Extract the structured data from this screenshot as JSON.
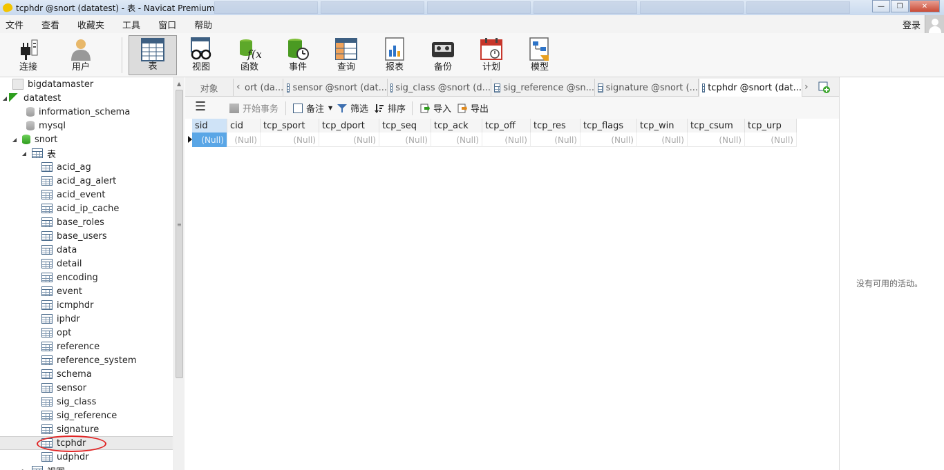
{
  "window": {
    "title": "tcphdr @snort (datatest) - 表 - Navicat Premium",
    "controls": [
      "—",
      "❐",
      "✕"
    ]
  },
  "menu": {
    "items": [
      "文件",
      "查看",
      "收藏夹",
      "工具",
      "窗口",
      "帮助"
    ],
    "login": "登录"
  },
  "toolbar": {
    "buttons": [
      {
        "label": "连接",
        "icon": "plug-icon"
      },
      {
        "label": "用户",
        "icon": "user-icon"
      },
      {
        "label": "表",
        "icon": "table-icon",
        "active": true
      },
      {
        "label": "视图",
        "icon": "view-glasses-icon"
      },
      {
        "label": "函数",
        "icon": "function-icon"
      },
      {
        "label": "事件",
        "icon": "event-clock-icon"
      },
      {
        "label": "查询",
        "icon": "query-icon"
      },
      {
        "label": "报表",
        "icon": "report-icon"
      },
      {
        "label": "备份",
        "icon": "backup-tape-icon"
      },
      {
        "label": "计划",
        "icon": "calendar-icon"
      },
      {
        "label": "模型",
        "icon": "model-icon"
      }
    ]
  },
  "tree": {
    "nodes": [
      {
        "label": "bigdatamaster",
        "level": 0,
        "type": "connection"
      },
      {
        "label": "datatest",
        "level": 0,
        "type": "connection-open",
        "expanded": true
      },
      {
        "label": "information_schema",
        "level": 1,
        "type": "database"
      },
      {
        "label": "mysql",
        "level": 1,
        "type": "database"
      },
      {
        "label": "snort",
        "level": 1,
        "type": "database-open",
        "expanded": true
      },
      {
        "label": "表",
        "level": 2,
        "type": "folder",
        "expanded": true
      },
      {
        "label": "acid_ag",
        "level": 3,
        "type": "table"
      },
      {
        "label": "acid_ag_alert",
        "level": 3,
        "type": "table"
      },
      {
        "label": "acid_event",
        "level": 3,
        "type": "table"
      },
      {
        "label": "acid_ip_cache",
        "level": 3,
        "type": "table"
      },
      {
        "label": "base_roles",
        "level": 3,
        "type": "table"
      },
      {
        "label": "base_users",
        "level": 3,
        "type": "table"
      },
      {
        "label": "data",
        "level": 3,
        "type": "table"
      },
      {
        "label": "detail",
        "level": 3,
        "type": "table"
      },
      {
        "label": "encoding",
        "level": 3,
        "type": "table"
      },
      {
        "label": "event",
        "level": 3,
        "type": "table"
      },
      {
        "label": "icmphdr",
        "level": 3,
        "type": "table"
      },
      {
        "label": "iphdr",
        "level": 3,
        "type": "table"
      },
      {
        "label": "opt",
        "level": 3,
        "type": "table"
      },
      {
        "label": "reference",
        "level": 3,
        "type": "table"
      },
      {
        "label": "reference_system",
        "level": 3,
        "type": "table"
      },
      {
        "label": "schema",
        "level": 3,
        "type": "table"
      },
      {
        "label": "sensor",
        "level": 3,
        "type": "table"
      },
      {
        "label": "sig_class",
        "level": 3,
        "type": "table"
      },
      {
        "label": "sig_reference",
        "level": 3,
        "type": "table"
      },
      {
        "label": "signature",
        "level": 3,
        "type": "table"
      },
      {
        "label": "tcphdr",
        "level": 3,
        "type": "table",
        "selected": true
      },
      {
        "label": "udphdr",
        "level": 3,
        "type": "table"
      },
      {
        "label": "视图",
        "level": 2,
        "type": "folder"
      }
    ]
  },
  "tabs": {
    "objects_label": "对象",
    "items": [
      {
        "label": "ort (da..."
      },
      {
        "label": "sensor @snort (dat..."
      },
      {
        "label": "sig_class @snort (d..."
      },
      {
        "label": "sig_reference @sn..."
      },
      {
        "label": "signature @snort (..."
      },
      {
        "label": "tcphdr @snort (dat...",
        "active": true
      }
    ]
  },
  "subtoolbar": {
    "begin_transaction": "开始事务",
    "memo": "备注",
    "filter": "筛选",
    "sort": "排序",
    "import": "导入",
    "export": "导出"
  },
  "grid": {
    "columns": [
      "sid",
      "cid",
      "tcp_sport",
      "tcp_dport",
      "tcp_seq",
      "tcp_ack",
      "tcp_off",
      "tcp_res",
      "tcp_flags",
      "tcp_win",
      "tcp_csum",
      "tcp_urp"
    ],
    "rows": [
      [
        "(Null)",
        "(Null)",
        "(Null)",
        "(Null)",
        "(Null)",
        "(Null)",
        "(Null)",
        "(Null)",
        "(Null)",
        "(Null)",
        "(Null)",
        "(Null)"
      ]
    ]
  },
  "right_panel": {
    "empty_text": "没有可用的活动。"
  },
  "colors": {
    "selection_blue": "#5aa6e6",
    "header_selected": "#cfe3f7",
    "highlight_red": "#e02424",
    "navicat_green": "#2d9f1e"
  }
}
